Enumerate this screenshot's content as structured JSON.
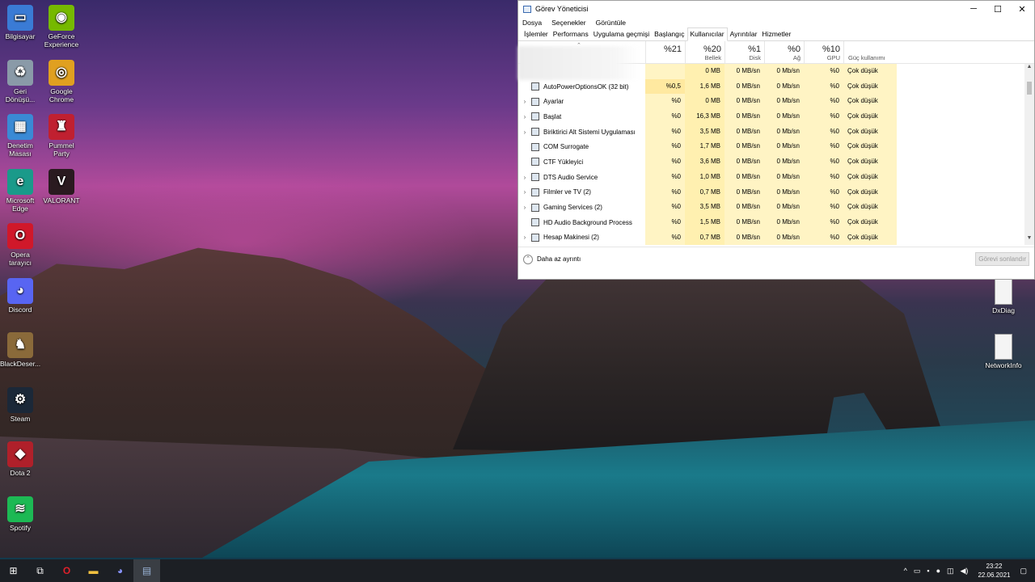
{
  "desktop": {
    "icons_left": [
      {
        "label": "Bilgisayar",
        "icon": "computer-icon",
        "color": "#3a7bd5",
        "glyph": "▭"
      },
      {
        "label": "Geri Dönüşü...",
        "icon": "recycle-bin-icon",
        "color": "#8a9aa8",
        "glyph": "♻"
      },
      {
        "label": "Denetim Masası",
        "icon": "control-panel-icon",
        "color": "#3a8ad5",
        "glyph": "▦"
      },
      {
        "label": "Microsoft Edge",
        "icon": "edge-icon",
        "color": "#1a9a8a",
        "glyph": "e"
      },
      {
        "label": "Opera tarayıcı",
        "icon": "opera-icon",
        "color": "#d0182a",
        "glyph": "O"
      },
      {
        "label": "Discord",
        "icon": "discord-icon",
        "color": "#5865f2",
        "glyph": "◕"
      },
      {
        "label": "BlackDeser...",
        "icon": "black-desert-icon",
        "color": "#8a6a3a",
        "glyph": "♞"
      },
      {
        "label": "Steam",
        "icon": "steam-icon",
        "color": "#1b2838",
        "glyph": "⚙"
      },
      {
        "label": "Dota 2",
        "icon": "dota2-icon",
        "color": "#b0202a",
        "glyph": "◆"
      },
      {
        "label": "Spotify",
        "icon": "spotify-icon",
        "color": "#1db954",
        "glyph": "≋"
      }
    ],
    "icons_col2": [
      {
        "label": "GeForce Experience",
        "icon": "geforce-icon",
        "color": "#76b900",
        "glyph": "◉"
      },
      {
        "label": "Google Chrome",
        "icon": "chrome-icon",
        "color": "#e0a020",
        "glyph": "◎"
      },
      {
        "label": "Pummel Party",
        "icon": "pummel-party-icon",
        "color": "#c02030",
        "glyph": "♜"
      },
      {
        "label": "VALORANT",
        "icon": "valorant-icon",
        "color": "#2a1a20",
        "glyph": "V"
      }
    ],
    "icons_right": [
      {
        "label": "DxDiag",
        "icon": "file-icon"
      },
      {
        "label": "NetworkInfo",
        "icon": "file-icon"
      }
    ]
  },
  "task_manager": {
    "title": "Görev Yöneticisi",
    "menu": [
      "Dosya",
      "Seçenekler",
      "Görüntüle"
    ],
    "tabs": [
      "İşlemler",
      "Performans",
      "Uygulama geçmişi",
      "Başlangıç",
      "Kullanıcılar",
      "Ayrıntılar",
      "Hizmetler"
    ],
    "active_tab": "Kullanıcılar",
    "columns": {
      "cpu": {
        "pct": "%21",
        "label": ""
      },
      "mem": {
        "pct": "%20",
        "label": "Bellek"
      },
      "disk": {
        "pct": "%1",
        "label": "Disk"
      },
      "net": {
        "pct": "%0",
        "label": "Ağ"
      },
      "gpu": {
        "pct": "%10",
        "label": "GPU"
      },
      "power": {
        "label": "Güç kullanımı"
      }
    },
    "rows": [
      {
        "name": "",
        "expandable": false,
        "cpu": "",
        "mem": "0 MB",
        "disk": "0 MB/sn",
        "net": "0 Mb/sn",
        "gpu": "%0",
        "power": "Çok düşük"
      },
      {
        "name": "AutoPowerOptionsOK (32 bit)",
        "expandable": false,
        "cpu": "%0,5",
        "mem": "1,6 MB",
        "disk": "0 MB/sn",
        "net": "0 Mb/sn",
        "gpu": "%0",
        "power": "Çok düşük"
      },
      {
        "name": "Ayarlar",
        "expandable": true,
        "cpu": "%0",
        "mem": "0 MB",
        "disk": "0 MB/sn",
        "net": "0 Mb/sn",
        "gpu": "%0",
        "power": "Çok düşük"
      },
      {
        "name": "Başlat",
        "expandable": true,
        "cpu": "%0",
        "mem": "16,3 MB",
        "disk": "0 MB/sn",
        "net": "0 Mb/sn",
        "gpu": "%0",
        "power": "Çok düşük"
      },
      {
        "name": "Biriktirici Alt Sistemi Uygulaması",
        "expandable": true,
        "cpu": "%0",
        "mem": "3,5 MB",
        "disk": "0 MB/sn",
        "net": "0 Mb/sn",
        "gpu": "%0",
        "power": "Çok düşük"
      },
      {
        "name": "COM Surrogate",
        "expandable": false,
        "cpu": "%0",
        "mem": "1,7 MB",
        "disk": "0 MB/sn",
        "net": "0 Mb/sn",
        "gpu": "%0",
        "power": "Çok düşük"
      },
      {
        "name": "CTF Yükleyici",
        "expandable": false,
        "cpu": "%0",
        "mem": "3,6 MB",
        "disk": "0 MB/sn",
        "net": "0 Mb/sn",
        "gpu": "%0",
        "power": "Çok düşük"
      },
      {
        "name": "DTS Audio Service",
        "expandable": true,
        "cpu": "%0",
        "mem": "1,0 MB",
        "disk": "0 MB/sn",
        "net": "0 Mb/sn",
        "gpu": "%0",
        "power": "Çok düşük"
      },
      {
        "name": "Filmler ve TV (2)",
        "expandable": true,
        "cpu": "%0",
        "mem": "0,7 MB",
        "disk": "0 MB/sn",
        "net": "0 Mb/sn",
        "gpu": "%0",
        "power": "Çok düşük"
      },
      {
        "name": "Gaming Services (2)",
        "expandable": true,
        "cpu": "%0",
        "mem": "3,5 MB",
        "disk": "0 MB/sn",
        "net": "0 Mb/sn",
        "gpu": "%0",
        "power": "Çok düşük"
      },
      {
        "name": "HD Audio Background Process",
        "expandable": false,
        "cpu": "%0",
        "mem": "1,5 MB",
        "disk": "0 MB/sn",
        "net": "0 Mb/sn",
        "gpu": "%0",
        "power": "Çok düşük"
      },
      {
        "name": "Hesap Makinesi (2)",
        "expandable": true,
        "cpu": "%0",
        "mem": "0,7 MB",
        "disk": "0 MB/sn",
        "net": "0 Mb/sn",
        "gpu": "%0",
        "power": "Çok düşük"
      }
    ],
    "footer": {
      "less_details": "Daha az ayrıntı",
      "end_task": "Görevi sonlandır"
    }
  },
  "taskbar": {
    "apps": [
      "start-icon",
      "task-view-icon",
      "opera-icon",
      "file-explorer-icon",
      "discord-icon",
      "task-manager-icon"
    ],
    "clock_time": "23:22",
    "clock_date": "22.06.2021"
  }
}
